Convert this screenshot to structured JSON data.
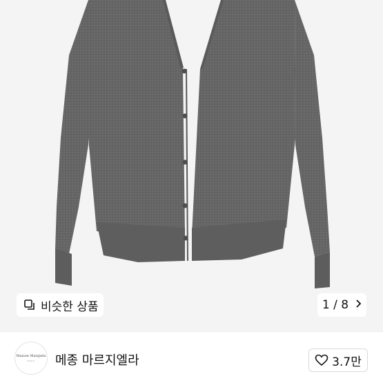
{
  "product_image": {
    "subject": "charcoal grey cardigan",
    "bg_color": "#f4f4f4",
    "garment_color": "#646464"
  },
  "similar_button": {
    "label": "비슷한 상품",
    "icon": "copy-icon"
  },
  "image_counter": {
    "current": 1,
    "total": 8,
    "label": "1 / 8",
    "icon": "chevron-right-icon"
  },
  "seller": {
    "logo_text": "Maison Margiela",
    "logo_subtext": "PARIS",
    "name": "메종 마르지엘라"
  },
  "like_button": {
    "count": "3.7만",
    "icon": "heart-outline-icon"
  }
}
